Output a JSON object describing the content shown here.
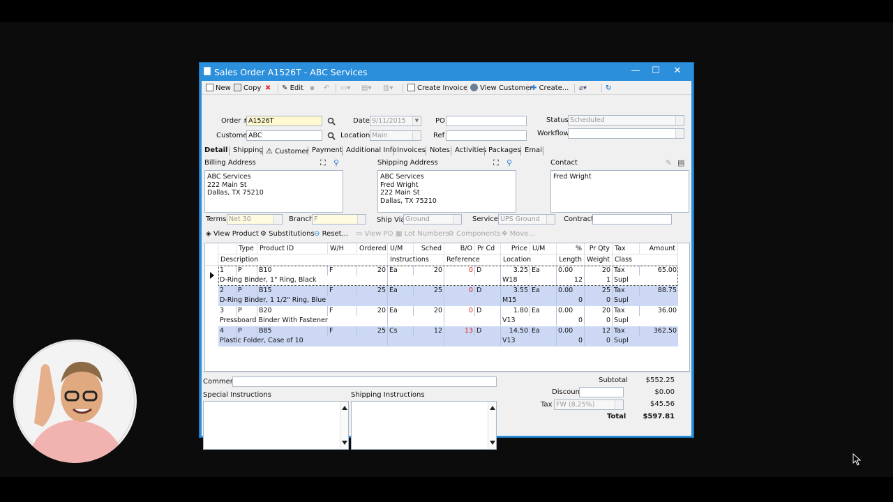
{
  "window": {
    "title": "Sales Order A1526T - ABC Services",
    "controls": {
      "minimize": "—",
      "maximize": "☐",
      "close": "✕"
    }
  },
  "toolbar": {
    "new": "New",
    "copy": "Copy",
    "edit": "Edit",
    "create_invoice": "Create Invoice",
    "view_customer": "View Customer",
    "create": "Create..."
  },
  "header": {
    "order_label": "Order #",
    "order_value": "A1526T",
    "customer_label": "Customer",
    "customer_value": "ABC",
    "date_label": "Date",
    "date_value": "9/11/2015",
    "location_label": "Location",
    "location_value": "Main",
    "po_label": "PO",
    "po_value": "",
    "ref_label": "Ref",
    "ref_value": "",
    "status_label": "Status",
    "status_value": "Scheduled",
    "workflow_label": "Workflow",
    "workflow_value": ""
  },
  "tabs": [
    "Detail",
    "Shipping",
    "Customer",
    "Payment",
    "Additional Info",
    "Invoices",
    "Notes",
    "Activities",
    "Packages",
    "Email"
  ],
  "billing": {
    "label": "Billing Address",
    "lines": [
      "ABC Services",
      "222 Main St",
      "Dallas, TX 75210"
    ]
  },
  "shipping": {
    "label": "Shipping Address",
    "lines": [
      "ABC Services",
      "Fred Wright",
      "222 Main St",
      "Dallas, TX 75210"
    ]
  },
  "contact": {
    "label": "Contact",
    "lines": [
      "Fred Wright"
    ]
  },
  "terms": {
    "terms_label": "Terms",
    "terms_value": "Net 30",
    "branch_label": "Branch",
    "branch_value": "F",
    "shipvia_label": "Ship Via",
    "shipvia_value": "Ground",
    "service_label": "Service",
    "service_value": "UPS Ground",
    "contract_label": "Contract",
    "contract_value": ""
  },
  "subtoolbar": {
    "view_product": "View Product",
    "substitutions": "Substitutions",
    "reset": "Reset...",
    "view_po": "View PO",
    "lot_numbers": "Lot Numbers",
    "components": "Components",
    "move": "Move..."
  },
  "grid": {
    "header1": [
      "Type",
      "Product ID",
      "W/H",
      "Ordered",
      "U/M",
      "Sched",
      "B/O",
      "Pr Cd",
      "Price",
      "U/M",
      "%",
      "Pr Qty",
      "Tax",
      "Amount"
    ],
    "header2": [
      "Description",
      "Instructions",
      "Reference",
      "Location",
      "Length",
      "Weight",
      "Class"
    ],
    "rows": [
      {
        "line": "1",
        "type": "P",
        "product": "B10",
        "wh": "F",
        "ordered": "20",
        "um": "Ea",
        "sched": "20",
        "bo": "0",
        "prcd": "D",
        "price": "3.25",
        "um2": "Ea",
        "pct": "0.00",
        "prqty": "20",
        "tax": "Tax",
        "amount": "65.00",
        "desc": "D-Ring Binder, 1\" Ring, Black",
        "location": "W18",
        "length": "12",
        "weight": "1",
        "class": "Supl"
      },
      {
        "line": "2",
        "type": "P",
        "product": "B15",
        "wh": "F",
        "ordered": "25",
        "um": "Ea",
        "sched": "25",
        "bo": "0",
        "prcd": "D",
        "price": "3.55",
        "um2": "Ea",
        "pct": "0.00",
        "prqty": "25",
        "tax": "Tax",
        "amount": "88.75",
        "desc": "D-Ring Binder, 1 1/2\" Ring, Blue",
        "location": "M15",
        "length": "0",
        "weight": "0",
        "class": "Supl"
      },
      {
        "line": "3",
        "type": "P",
        "product": "B20",
        "wh": "F",
        "ordered": "20",
        "um": "Ea",
        "sched": "20",
        "bo": "0",
        "prcd": "D",
        "price": "1.80",
        "um2": "Ea",
        "pct": "0.00",
        "prqty": "20",
        "tax": "Tax",
        "amount": "36.00",
        "desc": "Pressboard Binder With Fastener",
        "location": "V13",
        "length": "0",
        "weight": "0",
        "class": "Supl"
      },
      {
        "line": "4",
        "type": "P",
        "product": "B85",
        "wh": "F",
        "ordered": "25",
        "um": "Cs",
        "sched": "12",
        "bo": "13",
        "prcd": "D",
        "price": "14.50",
        "um2": "Ea",
        "pct": "0.00",
        "prqty": "12",
        "tax": "Tax",
        "amount": "362.50",
        "desc": "Plastic Folder, Case of 10",
        "location": "V13",
        "length": "0",
        "weight": "0",
        "class": "Supl"
      }
    ]
  },
  "footer": {
    "comment_label": "Comment",
    "comment_value": "",
    "special_label": "Special Instructions",
    "shipping_instr_label": "Shipping Instructions",
    "subtotal_label": "Subtotal",
    "subtotal_value": "$552.25",
    "discount_label": "Discount",
    "discount_value": "$0.00",
    "tax_label": "Tax",
    "tax_code": "FW (8.25%)",
    "tax_value": "$45.56",
    "total_label": "Total",
    "total_value": "$597.81"
  },
  "colors": {
    "window_frame": "#2b8fdc",
    "row_alt": "#cdd9f4",
    "backorder": "#e02020",
    "order_field": "#fff9cf"
  }
}
